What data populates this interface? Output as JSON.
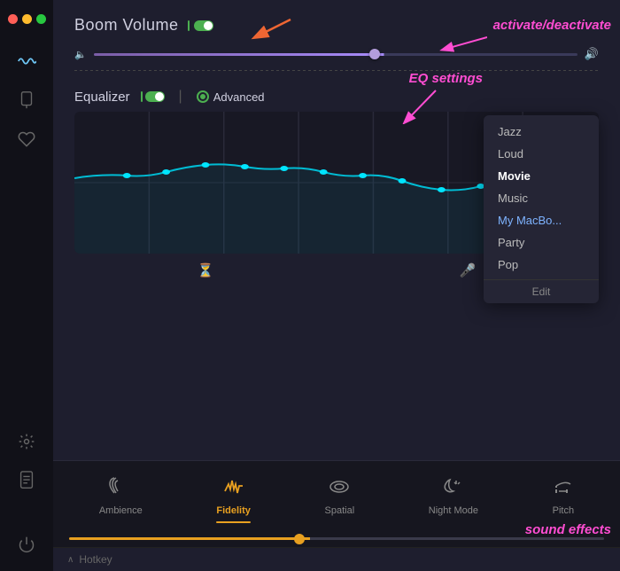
{
  "app": {
    "title": "Boom Volume"
  },
  "sidebar": {
    "icons": [
      {
        "name": "wave-icon",
        "symbol": "〜",
        "active": true
      },
      {
        "name": "bolt-icon",
        "symbol": "⚡",
        "active": false
      },
      {
        "name": "heart-icon",
        "symbol": "♡",
        "active": false
      },
      {
        "name": "gear-icon",
        "symbol": "⚙",
        "active": false
      },
      {
        "name": "document-icon",
        "symbol": "📄",
        "active": false
      }
    ]
  },
  "volume": {
    "title": "Boom Volume",
    "toggle_state": "on",
    "slider_percent": 60
  },
  "equalizer": {
    "title": "Equalizer",
    "toggle_state": "on",
    "advanced_label": "Advanced"
  },
  "eq_presets": [
    {
      "id": "jazz",
      "label": "Jazz",
      "selected": false
    },
    {
      "id": "loud",
      "label": "Loud",
      "selected": false
    },
    {
      "id": "movie",
      "label": "Movie",
      "selected": true
    },
    {
      "id": "music",
      "label": "Music",
      "selected": false
    },
    {
      "id": "my-macbo",
      "label": "My MacBo...",
      "selected": false,
      "accent": true
    },
    {
      "id": "party",
      "label": "Party",
      "selected": false
    },
    {
      "id": "pop",
      "label": "Pop",
      "selected": false
    }
  ],
  "eq_dropdown_edit": "Edit",
  "annotations": {
    "activate": "activate/deactivate",
    "eq_settings": "EQ settings",
    "sound_effects": "sound effects"
  },
  "effects": {
    "tabs": [
      {
        "id": "ambience",
        "label": "Ambience",
        "icon": "ambience",
        "active": false
      },
      {
        "id": "fidelity",
        "label": "Fidelity",
        "icon": "fidelity",
        "active": true
      },
      {
        "id": "spatial",
        "label": "Spatial",
        "icon": "spatial",
        "active": false
      },
      {
        "id": "night-mode",
        "label": "Night Mode",
        "icon": "night-mode",
        "active": false
      },
      {
        "id": "pitch",
        "label": "Pitch",
        "icon": "pitch",
        "active": false
      }
    ],
    "slider_percent": 43
  },
  "hotkey": {
    "label": "Hotkey"
  }
}
